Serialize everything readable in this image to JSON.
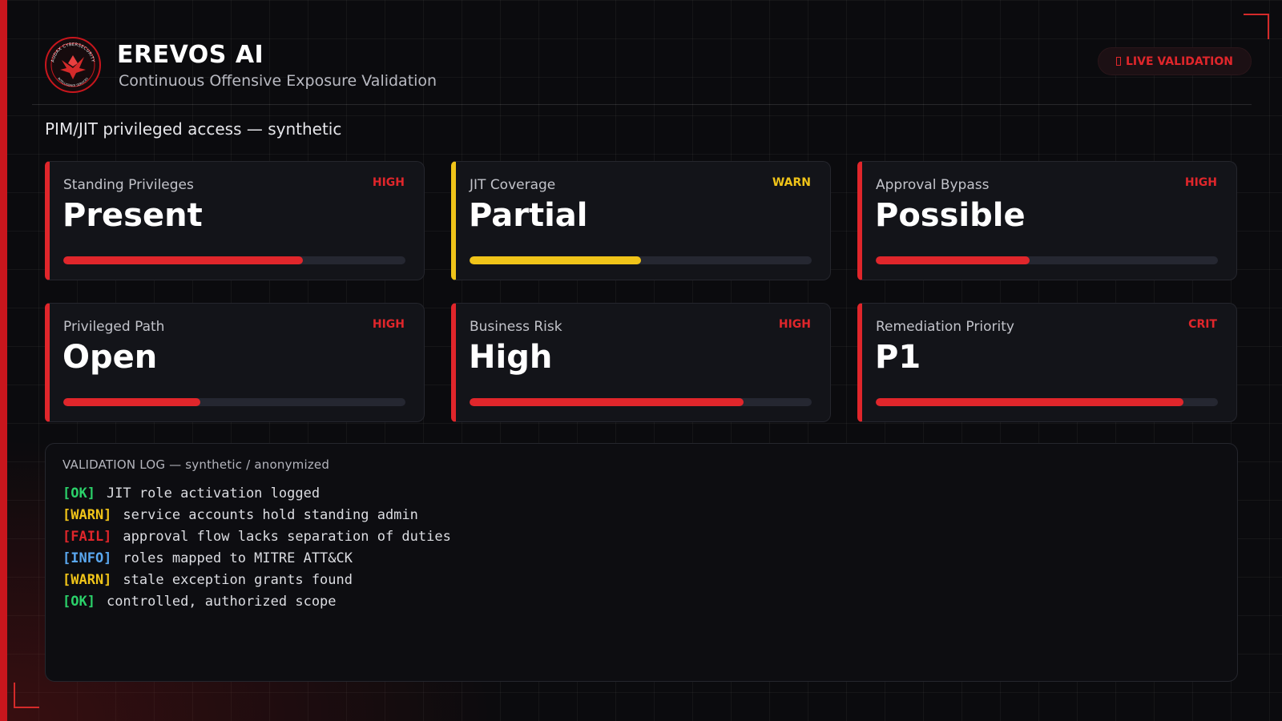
{
  "header": {
    "title": "EREVOS AI",
    "subtitle": "Continuous Offensive Exposure Validation",
    "logo_text_top": "AUDAX CYBERSECURITY",
    "logo_text_bottom": "INTELLIGENCE SERVICES",
    "live_label": "LIVE VALIDATION"
  },
  "section_title": "PIM/JIT privileged access — synthetic",
  "colors": {
    "accent_red": "#e0262b",
    "warn_yellow": "#f0c419",
    "ok_green": "#2bd16a",
    "info_blue": "#5aa8f0"
  },
  "cards": [
    {
      "label": "Standing Privileges",
      "badge": "HIGH",
      "value": "Present",
      "progress": 0.7,
      "severity": "high"
    },
    {
      "label": "JIT Coverage",
      "badge": "WARN",
      "value": "Partial",
      "progress": 0.5,
      "severity": "warn"
    },
    {
      "label": "Approval Bypass",
      "badge": "HIGH",
      "value": "Possible",
      "progress": 0.45,
      "severity": "high"
    },
    {
      "label": "Privileged Path",
      "badge": "HIGH",
      "value": "Open",
      "progress": 0.4,
      "severity": "high"
    },
    {
      "label": "Business Risk",
      "badge": "HIGH",
      "value": "High",
      "progress": 0.8,
      "severity": "high"
    },
    {
      "label": "Remediation Priority",
      "badge": "CRIT",
      "value": "P1",
      "progress": 0.9,
      "severity": "crit"
    }
  ],
  "log": {
    "title": "VALIDATION LOG — synthetic / anonymized",
    "lines": [
      {
        "tag": "[OK]",
        "level": "ok",
        "text": "JIT role activation logged"
      },
      {
        "tag": "[WARN]",
        "level": "warn",
        "text": "service accounts hold standing admin"
      },
      {
        "tag": "[FAIL]",
        "level": "fail",
        "text": "approval flow lacks separation of duties"
      },
      {
        "tag": "[INFO]",
        "level": "info",
        "text": "roles mapped to MITRE ATT&CK"
      },
      {
        "tag": "[WARN]",
        "level": "warn",
        "text": "stale exception grants found"
      },
      {
        "tag": "[OK]",
        "level": "ok",
        "text": "controlled, authorized scope"
      }
    ]
  }
}
